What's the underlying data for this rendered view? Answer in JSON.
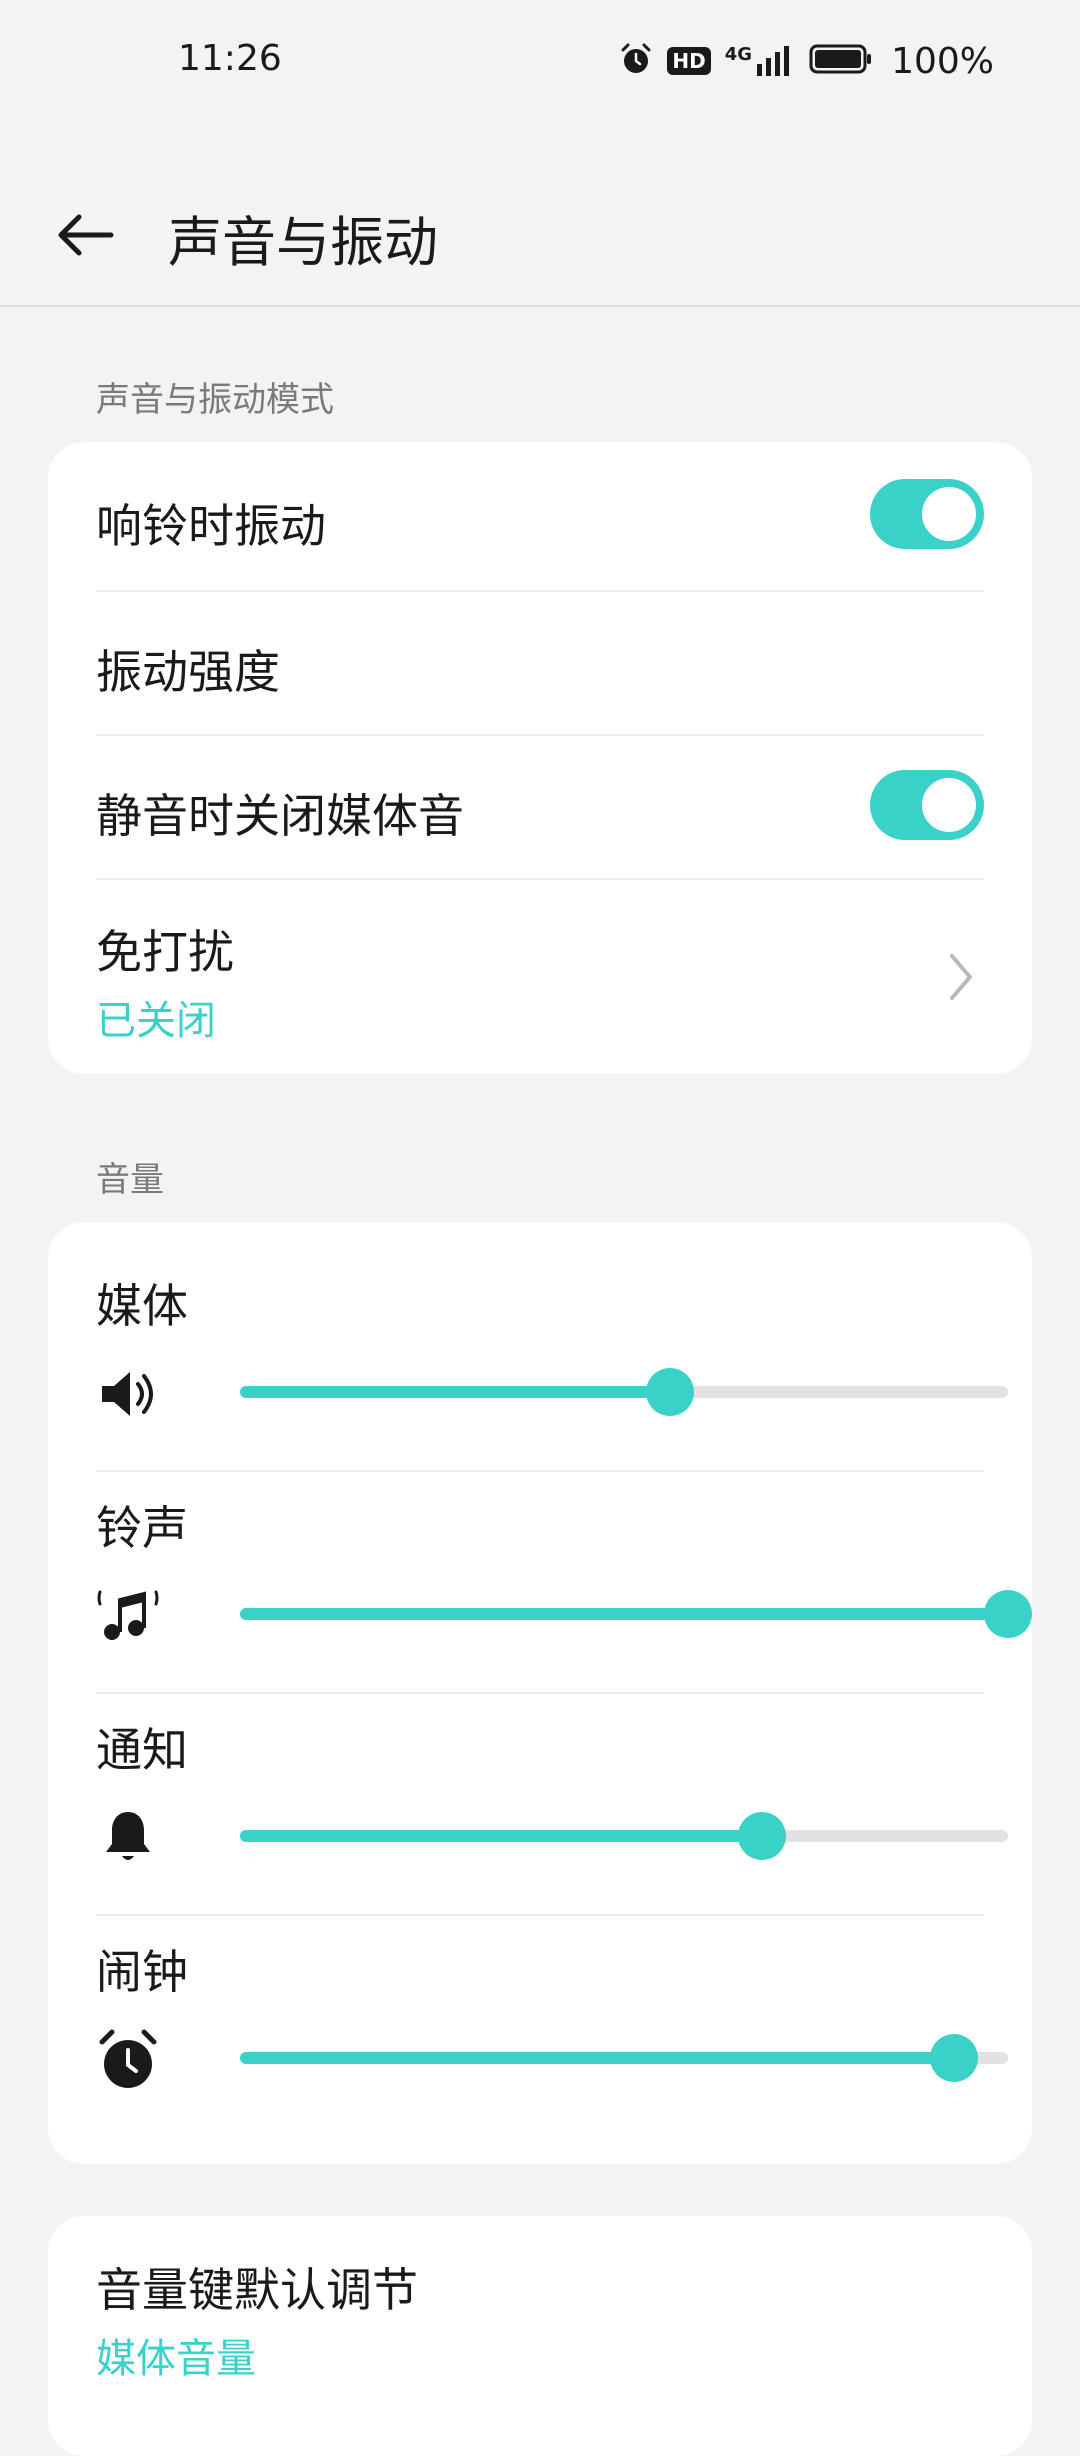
{
  "status_bar": {
    "time": "11:26",
    "hd": "HD",
    "network": "4G",
    "battery": "100%"
  },
  "header": {
    "title": "声音与振动"
  },
  "sections": {
    "mode_label": "声音与振动模式",
    "volume_label": "音量"
  },
  "mode_card": {
    "ring_vibrate": {
      "label": "响铃时振动",
      "on": true
    },
    "vibrate_strength": {
      "label": "振动强度"
    },
    "mute_media": {
      "label": "静音时关闭媒体音",
      "on": true
    },
    "dnd": {
      "label": "免打扰",
      "status": "已关闭"
    }
  },
  "volume": {
    "sliders": [
      {
        "label": "媒体",
        "icon": "speaker-icon",
        "level": 0.56
      },
      {
        "label": "铃声",
        "icon": "ringtone-icon",
        "level": 1.0
      },
      {
        "label": "通知",
        "icon": "bell-icon",
        "level": 0.68
      },
      {
        "label": "闹钟",
        "icon": "alarm-clock-icon",
        "level": 0.93
      }
    ]
  },
  "volume_key": {
    "label": "音量键默认调节",
    "value": "媒体音量"
  },
  "colors": {
    "accent": "#3ad1c9",
    "background": "#f2f3f5",
    "card": "#ffffff"
  }
}
